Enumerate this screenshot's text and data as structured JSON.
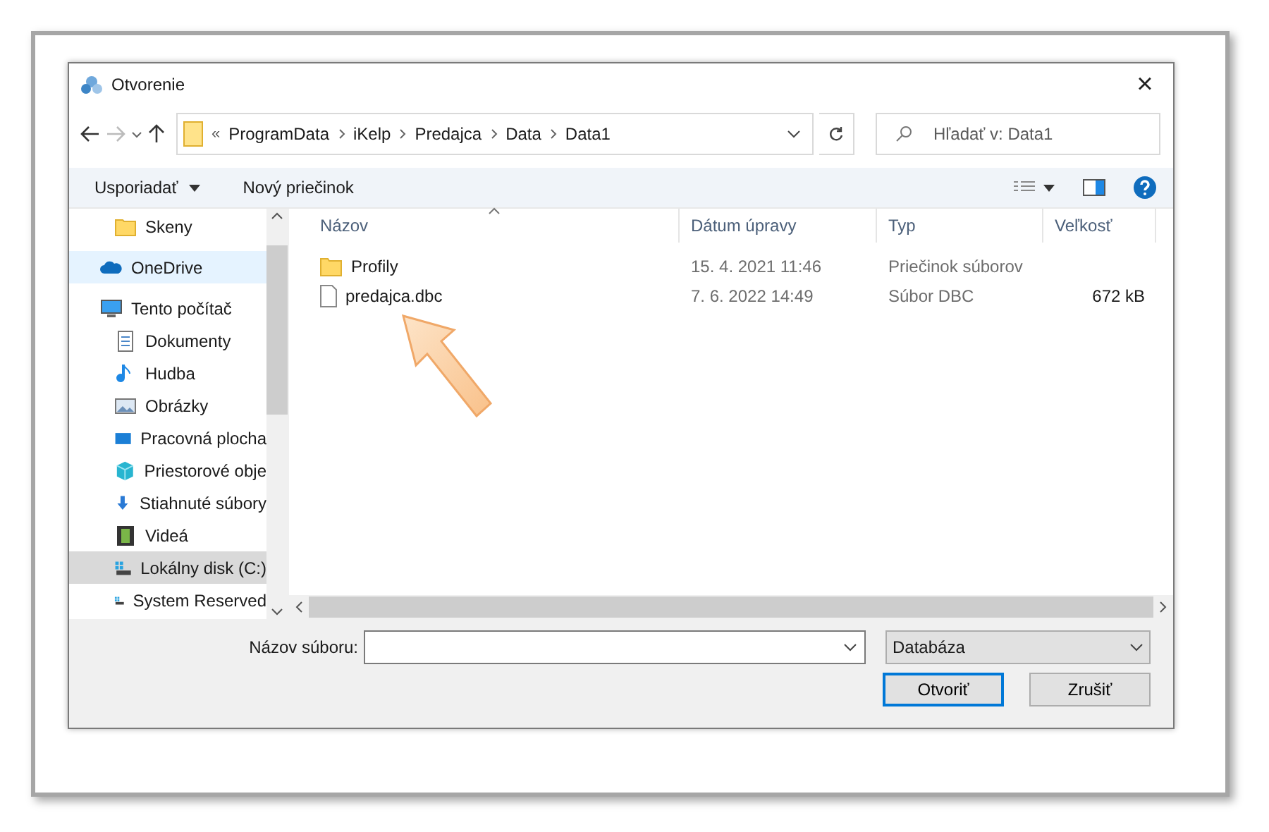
{
  "window": {
    "title": "Otvorenie",
    "close": "×"
  },
  "address": {
    "overflow": "«",
    "path": [
      "ProgramData",
      "iKelp",
      "Predajca",
      "Data",
      "Data1"
    ]
  },
  "search": {
    "placeholder": "Hľadať v: Data1"
  },
  "commands": [
    {
      "label": "Usporiadať",
      "menu": true
    },
    {
      "label": "Nový priečinok",
      "menu": false
    }
  ],
  "sidebar": {
    "items": [
      {
        "label": "Skeny",
        "kind": "folder",
        "selected": false,
        "hovered": false
      },
      {
        "label": "OneDrive",
        "kind": "cloud",
        "selected": false,
        "hovered": true
      },
      {
        "label": "Tento počítač",
        "kind": "computer",
        "selected": false,
        "hovered": false,
        "children": [
          {
            "label": "Dokumenty",
            "kind": "document",
            "selected": false,
            "hovered": false
          },
          {
            "label": "Hudba",
            "kind": "music",
            "selected": false,
            "hovered": false
          },
          {
            "label": "Obrázky",
            "kind": "picture",
            "selected": false,
            "hovered": false
          },
          {
            "label": "Pracovná plocha",
            "kind": "desktop",
            "selected": false,
            "hovered": false
          },
          {
            "label": "Priestorové obje",
            "kind": "cube",
            "selected": false,
            "hovered": false
          },
          {
            "label": "Stiahnuté súbory",
            "kind": "download",
            "selected": false,
            "hovered": false
          },
          {
            "label": "Videá",
            "kind": "video",
            "selected": false,
            "hovered": false
          },
          {
            "label": "Lokálny disk (C:)",
            "kind": "drive",
            "selected": true,
            "hovered": false
          },
          {
            "label": "System Reserved",
            "kind": "drive",
            "selected": false,
            "hovered": false
          }
        ]
      }
    ]
  },
  "table": {
    "columns": [
      "Názov",
      "Dátum úpravy",
      "Typ",
      "Veľkosť"
    ],
    "rows": [
      {
        "kind": "folder",
        "cells": [
          "Profily",
          "15. 4. 2021 11:46",
          "Priečinok súborov",
          ""
        ]
      },
      {
        "kind": "file",
        "cells": [
          "predajca.dbc",
          "7. 6. 2022 14:49",
          "Súbor DBC",
          "672 kB"
        ]
      }
    ]
  },
  "footer": {
    "filename_label": "Názov súboru:",
    "filetype": "Databáza",
    "buttons": [
      {
        "label": "Otvoriť",
        "default": true
      },
      {
        "label": "Zrušiť",
        "default": false
      }
    ]
  }
}
